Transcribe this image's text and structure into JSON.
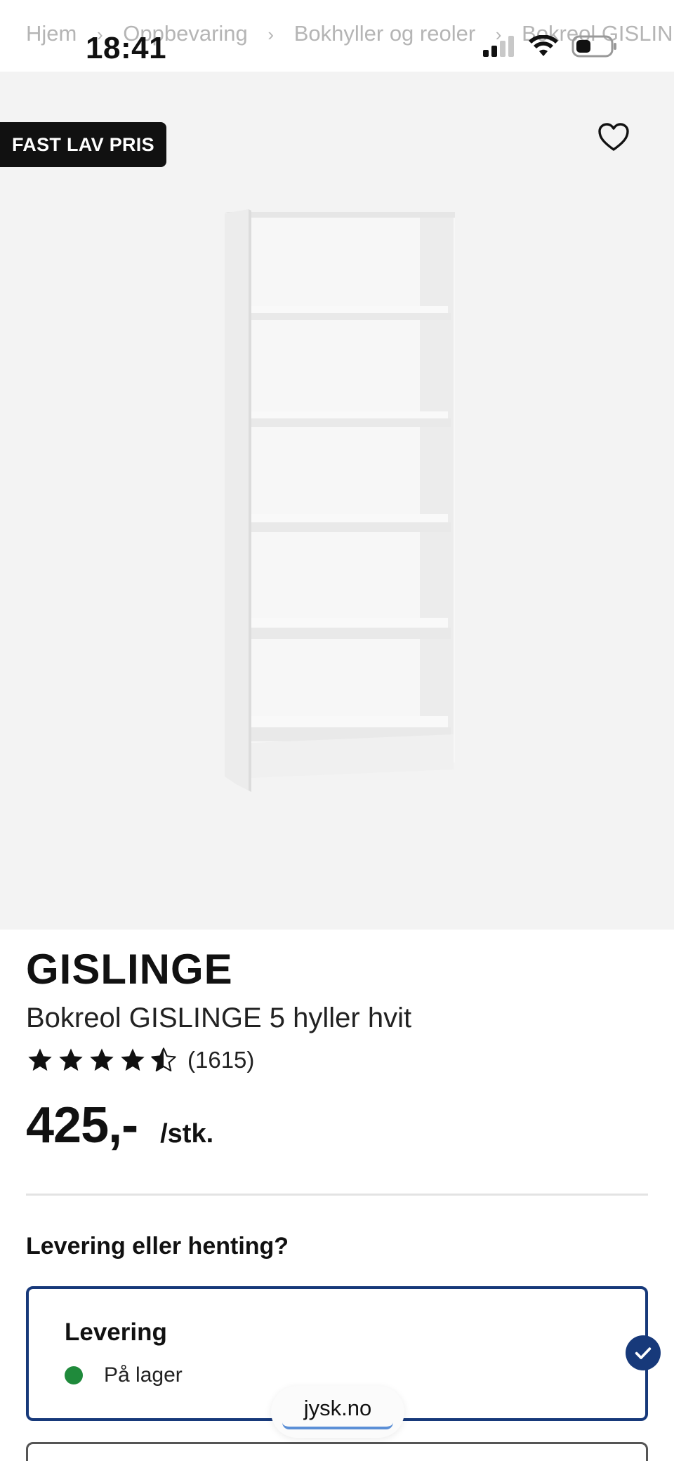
{
  "breadcrumb": {
    "items": [
      "Hjem",
      "Oppbevaring",
      "Bokhyller og reoler",
      "Bokreol GISLINGE"
    ]
  },
  "status_bar": {
    "time": "18:41",
    "icons": [
      "cellular-signal-icon",
      "wifi-icon",
      "battery-icon"
    ]
  },
  "hero": {
    "badge": "FAST LAV PRIS",
    "favorite_icon": "heart-outline-icon",
    "image": "white-bookshelf-5-shelves"
  },
  "product": {
    "brand": "GISLINGE",
    "name": "Bokreol GISLINGE 5 hyller hvit",
    "rating_stars": 4.5,
    "reviews": "(1615)",
    "price": "425,-",
    "unit": "/stk."
  },
  "delivery": {
    "title": "Levering eller henting?",
    "options": [
      {
        "label": "Levering",
        "stock": "På lager",
        "stock_color": "#1f8a3b",
        "selected": true
      }
    ]
  },
  "browser": {
    "url": "jysk.no"
  },
  "colors": {
    "accent": "#17397a",
    "badge_bg": "#111111",
    "hero_bg": "#f3f3f3"
  }
}
